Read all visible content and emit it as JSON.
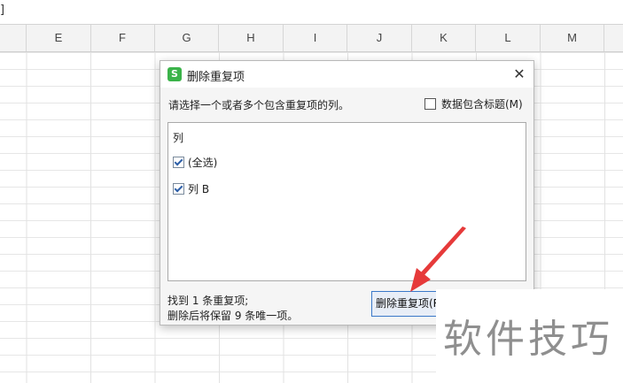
{
  "formula_bar": {
    "bracket": "]"
  },
  "columns": [
    "E",
    "F",
    "G",
    "H",
    "I",
    "J",
    "K",
    "L",
    "M"
  ],
  "dialog": {
    "app_icon_letter": "S",
    "title": "删除重复项",
    "close_glyph": "✕",
    "instruction": "请选择一个或者多个包含重复项的列。",
    "header_checkbox": {
      "label": "数据包含标题(M)",
      "checked": false
    },
    "list": {
      "header": "列",
      "items": [
        {
          "label": "(全选)",
          "checked": true
        },
        {
          "label": "列 B",
          "checked": true
        }
      ]
    },
    "status": {
      "line1": "找到 1 条重复项;",
      "line2": "删除后将保留 9 条唯一项。"
    },
    "primary_button": "删除重复项(R)"
  },
  "watermark": "软件技巧",
  "colors": {
    "accent": "#3a78c9",
    "arrow": "#e63a3a",
    "app_icon": "#3bb34a"
  }
}
